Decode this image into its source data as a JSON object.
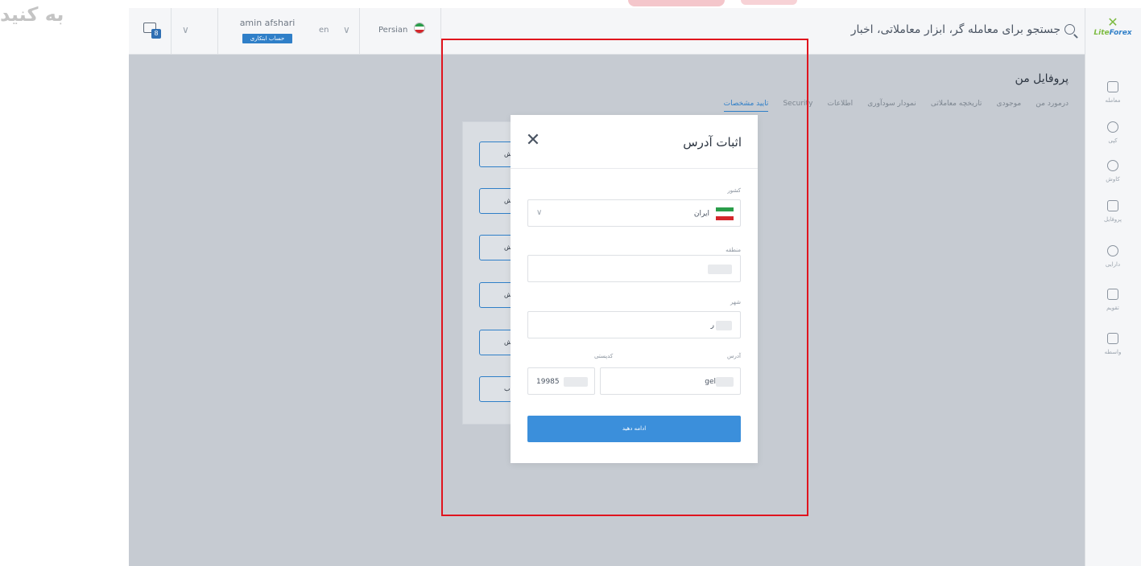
{
  "watermark": "به کنید",
  "topbar": {
    "search_placeholder": "جستجو برای معامله گر، ابزار معاملاتی، اخبار",
    "user_name": "amin afshari",
    "account_badge": "حساب ابتکاری",
    "lang_code": "en",
    "language": "Persian",
    "notif_count": "8"
  },
  "logo": {
    "text_a": "Lite",
    "text_b": "Forex"
  },
  "sidebar": {
    "items": [
      {
        "label": "معامله",
        "icon": "chart-icon"
      },
      {
        "label": "کپی",
        "icon": "user-icon"
      },
      {
        "label": "کاوش",
        "icon": "explore-icon"
      },
      {
        "label": "پروفایل",
        "icon": "profile-card-icon"
      },
      {
        "label": "دارایی",
        "icon": "dollar-icon"
      },
      {
        "label": "تقویم",
        "icon": "calendar-icon"
      },
      {
        "label": "واسطه",
        "icon": "handshake-icon"
      }
    ]
  },
  "page": {
    "title": "پروفایل من",
    "tabs": [
      "درمورد من",
      "موجودی",
      "تاریخچه معاملاتی",
      "نمودار سودآوری",
      "اطلاعات",
      "Security",
      "تایید مشخصات"
    ],
    "active_tab_index": 6
  },
  "modal": {
    "title": "اثبات آدرس",
    "country_label": "کشور",
    "country_value": "ایران",
    "region_label": "منطقه",
    "city_label": "شهر",
    "city_value": "ر",
    "address_label": "آدرس",
    "address_value": "gel",
    "postal_label": "کدپستی",
    "postal_value": "19985",
    "submit_label": "ادامه دهید"
  },
  "colors": {
    "accent": "#2f7fc8",
    "highlight": "#e0141e",
    "overlay": "#c6cbd2",
    "button": "#3b8fdb"
  }
}
